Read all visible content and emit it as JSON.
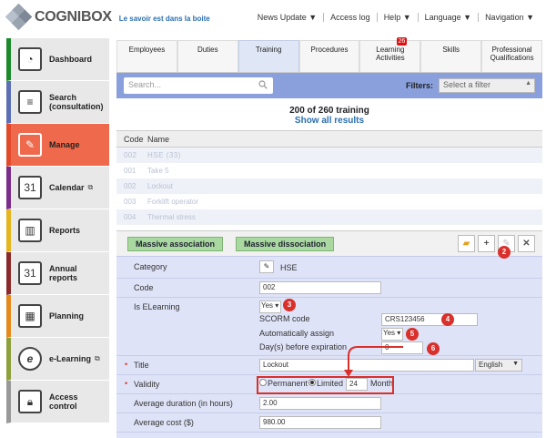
{
  "app": {
    "logo": "COGNIBOX",
    "tagline": "Le savoir est dans la boite"
  },
  "topnav": [
    "News Update ▼",
    "Access log",
    "Help ▼",
    "Language ▼",
    "Navigation ▼"
  ],
  "sidebar": [
    {
      "label": "Dashboard",
      "icon": "gauge-icon",
      "color": "#1a8a2a"
    },
    {
      "label": "Search\n(consultation)",
      "icon": "document-icon",
      "color": "#5b6fb5"
    },
    {
      "label": "Manage",
      "icon": "edit-icon",
      "color": "#e24a2a",
      "active": true
    },
    {
      "label": "Calendar",
      "icon": "calendar-icon",
      "color": "#7a2e8c",
      "ext": true
    },
    {
      "label": "Reports",
      "icon": "chart-icon",
      "color": "#e5b51a"
    },
    {
      "label": "Annual\nreports",
      "icon": "annual-report-icon",
      "color": "#8a2a2a"
    },
    {
      "label": "Planning",
      "icon": "planning-icon",
      "color": "#e58a1a"
    },
    {
      "label": "e-Learning",
      "icon": "elearning-icon",
      "color": "#8ea03a",
      "ext": true
    },
    {
      "label": "Access\ncontrol",
      "icon": "lock-icon",
      "color": "#999999"
    }
  ],
  "tabs": [
    {
      "label": "Employees"
    },
    {
      "label": "Duties"
    },
    {
      "label": "Training",
      "active": true
    },
    {
      "label": "Procedures"
    },
    {
      "label": "Learning\nActivities",
      "badge": "26"
    },
    {
      "label": "Skills"
    },
    {
      "label": "Professional\nQualifications"
    }
  ],
  "search": {
    "placeholder": "Search...",
    "filters_label": "Filters:",
    "filter_value": "Select a filter"
  },
  "results": {
    "count": "200 of 260 training",
    "show_all": "Show all results"
  },
  "table": {
    "headers": [
      "Code",
      "Name"
    ],
    "rows": [
      [
        "002",
        "HSE  (33)"
      ],
      [
        "001",
        "Take 5"
      ],
      [
        "002",
        "Lockout"
      ],
      [
        "003",
        "Forklift operator"
      ],
      [
        "004",
        "Thermal stress"
      ]
    ]
  },
  "actions": {
    "assoc": "Massive association",
    "dissoc": "Massive dissociation"
  },
  "form": {
    "category_label": "Category",
    "category_value": "HSE",
    "code_label": "Code",
    "code_value": "002",
    "elearning_label": "Is ELearning",
    "elearning_value": "Yes ▾",
    "scorm_label": "SCORM code",
    "scorm_value": "CRS123456",
    "autoassign_label": "Automatically assign",
    "autoassign_value": "Yes ▾",
    "days_label": "Day(s) before expiration",
    "days_value": "0",
    "title_label": "Title",
    "title_value": "Lockout",
    "lang_value": "English",
    "validity_label": "Validity",
    "permanent": "Permanent",
    "limited": "Limited",
    "validity_num": "24",
    "validity_unit": "Month",
    "duration_label": "Average duration (in hours)",
    "duration_value": "2.00",
    "cost_label": "Average cost ($)",
    "cost_value": "980.00"
  },
  "callouts": [
    "2",
    "3",
    "4",
    "5",
    "6"
  ],
  "colors": {
    "accent": "#2a6fb0",
    "callout": "#d9302b",
    "form_bg": "#dfe3f7",
    "search_bar": "#8aa0dd"
  }
}
